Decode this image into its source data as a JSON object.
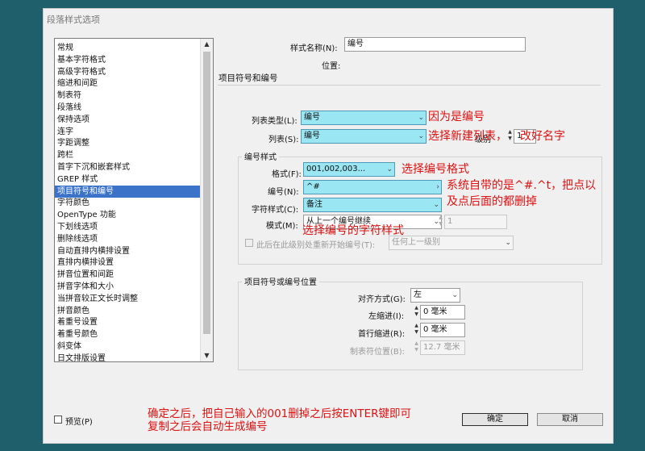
{
  "window": {
    "title": "段落样式选项"
  },
  "sidebar": {
    "items": [
      {
        "label": "常规"
      },
      {
        "label": "基本字符格式"
      },
      {
        "label": "高级字符格式"
      },
      {
        "label": "缩进和间距"
      },
      {
        "label": "制表符"
      },
      {
        "label": "段落线"
      },
      {
        "label": "保持选项"
      },
      {
        "label": "连字"
      },
      {
        "label": "字距调整"
      },
      {
        "label": "跨栏"
      },
      {
        "label": "首字下沉和嵌套样式"
      },
      {
        "label": "GREP 样式"
      },
      {
        "label": "项目符号和编号"
      },
      {
        "label": "字符颜色"
      },
      {
        "label": "OpenType 功能"
      },
      {
        "label": "下划线选项"
      },
      {
        "label": "删除线选项"
      },
      {
        "label": "自动直排内横排设置"
      },
      {
        "label": "直排内横排设置"
      },
      {
        "label": "拼音位置和间距"
      },
      {
        "label": "拼音字体和大小"
      },
      {
        "label": "当拼音较正文长时调整"
      },
      {
        "label": "拼音颜色"
      },
      {
        "label": "着重号设置"
      },
      {
        "label": "着重号颜色"
      },
      {
        "label": "斜变体"
      },
      {
        "label": "日文排版设置"
      }
    ],
    "selected_index": 12
  },
  "header": {
    "style_name_label": "样式名称(N):",
    "style_name_value": "编号",
    "location_label": "位置:",
    "section_title": "项目符号和编号"
  },
  "list": {
    "type_label": "列表类型(L):",
    "type_value": "编号",
    "list_label": "列表(S):",
    "list_value": "编号",
    "level_label": "级别",
    "level_value": "1"
  },
  "numbering": {
    "title": "编号样式",
    "format_label": "格式(F):",
    "format_value": "001,002,003...",
    "number_label": "编号(N):",
    "number_value": "^#",
    "char_style_label": "字符样式(C):",
    "char_style_value": "备注",
    "mode_label": "模式(M):",
    "mode_value": "从上一个编号继续",
    "mode_number": "1",
    "restart_label": "此后在此级别处重新开始编号(T):",
    "restart_value": "任何上一级别"
  },
  "position": {
    "title": "项目符号或编号位置",
    "align_label": "对齐方式(G):",
    "align_value": "左",
    "left_indent_label": "左缩进(I):",
    "left_indent_value": "0 毫米",
    "first_indent_label": "首行缩进(R):",
    "first_indent_value": "0 毫米",
    "tab_label": "制表符位置(B):",
    "tab_value": "12.7 毫米"
  },
  "footer": {
    "preview_label": "预览(P)",
    "ok_label": "确定",
    "cancel_label": "取消"
  },
  "annotations": {
    "a1": "因为是编号",
    "a2": "选择新建列表，",
    "a3": "改好名字",
    "a4": "选择编号格式",
    "a5_line1": "系统自带的是^#.^t，把点以",
    "a5_line2": "及点后面的都删掉",
    "a6": "选择编号的字符样式",
    "a7_line1": "确定之后，把自己输入的001删掉之后按ENTER键即可",
    "a7_line2": "复制之后会自动生成编号"
  },
  "colors": {
    "highlight": "#9ae6f3",
    "selection": "#3b73c9",
    "annotation": "#dd1111",
    "background": "#1f5f6b"
  }
}
